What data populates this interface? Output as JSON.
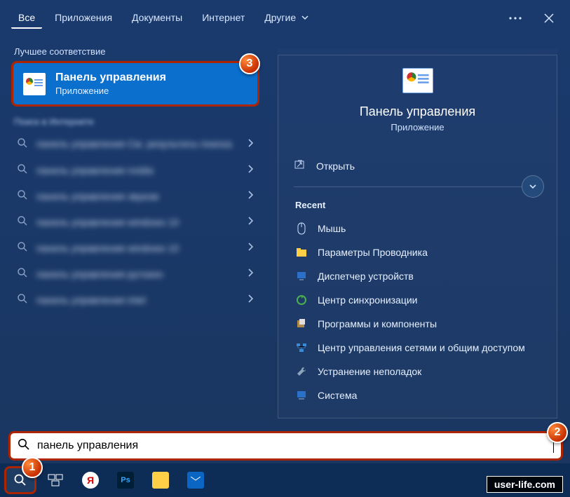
{
  "tabs": {
    "all": "Все",
    "apps": "Приложения",
    "docs": "Документы",
    "internet": "Интернет",
    "more": "Другие"
  },
  "left": {
    "best_match_label": "Лучшее соответствие",
    "best_match": {
      "title": "Панель управления",
      "subtitle": "Приложение"
    },
    "search_in_internet_label": "Поиск в Интернете",
    "results": [
      "панель управления   См. результаты поиска",
      "панель управления nvidia",
      "панель управления звуком",
      "панель управления windows 10",
      "панель управления windows 10",
      "панель управления рутокен",
      "панель управления intel"
    ]
  },
  "right": {
    "title": "Панель управления",
    "subtitle": "Приложение",
    "open_label": "Открыть",
    "recent_label": "Recent",
    "recent": [
      "Мышь",
      "Параметры Проводника",
      "Диспетчер устройств",
      "Центр синхронизации",
      "Программы и компоненты",
      "Центр управления сетями и общим доступом",
      "Устранение неполадок",
      "Система"
    ]
  },
  "search_input": "панель управления",
  "badges": {
    "one": "1",
    "two": "2",
    "three": "3"
  },
  "watermark": "user-life.com"
}
